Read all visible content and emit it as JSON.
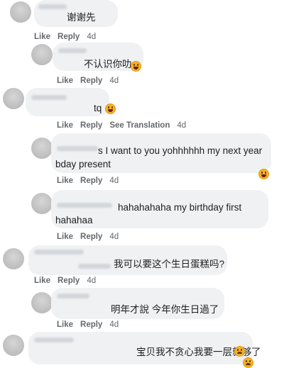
{
  "actions": {
    "like": "Like",
    "reply": "Reply",
    "see_translation": "See Translation"
  },
  "comments": [
    {
      "text": "谢谢先",
      "age": "4d"
    },
    {
      "text": "不认识你叻",
      "age": "4d"
    },
    {
      "text": "tq",
      "age": "4d"
    },
    {
      "text_line1": "s I want to you yohhhhhh my next year",
      "text_line2": "bday present",
      "age": "4d"
    },
    {
      "text_line1": "hahahahaha my birthday first",
      "text_line2": "hahahaa",
      "age": "4d"
    },
    {
      "text": "我可以要这个生日蛋糕吗?",
      "age": "4d"
    },
    {
      "text": "明年才說 今年你生日過了",
      "age": "4d"
    },
    {
      "text": "宝贝我不贪心我要一层就够了"
    }
  ],
  "icons": {
    "laugh": "laughing-emoji-icon",
    "sad": "sad-emoji-icon"
  }
}
